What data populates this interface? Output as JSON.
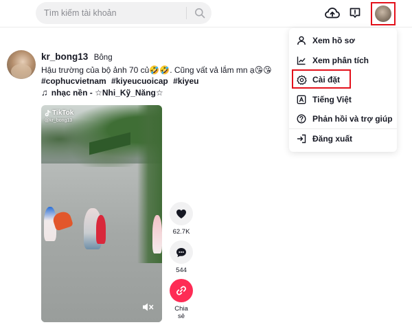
{
  "header": {
    "search_placeholder": "Tìm kiếm tài khoản",
    "icons": {
      "search": "search-icon",
      "upload": "cloud-upload-icon",
      "inbox": "inbox-icon",
      "avatar": "user-avatar"
    }
  },
  "post": {
    "username": "kr_bong13",
    "nickname": "Bông",
    "caption_line": "Hậu trường của bộ ảnh 70 củ🤣🤣. Cũng vất vả lắm mn ạ😘😘",
    "hashtags": [
      "#cophucvietnam",
      "#kiyeucuoicap",
      "#kiyeu"
    ],
    "music": "nhạc nền - ☆Nhi_Kỹ_Năng☆",
    "video": {
      "watermark": "TikTok",
      "handle": "@kr_bong13"
    },
    "actions": {
      "likes": "62.7K",
      "comments": "544",
      "share_label_line1": "Chia",
      "share_label_line2": "sẻ"
    }
  },
  "menu": {
    "items": [
      {
        "label": "Xem hồ sơ",
        "icon": "person-icon"
      },
      {
        "label": "Xem phân tích",
        "icon": "analytics-icon"
      },
      {
        "label": "Cài đặt",
        "icon": "settings-icon"
      },
      {
        "label": "Tiếng Việt",
        "icon": "language-icon"
      },
      {
        "label": "Phản hồi và trợ giúp",
        "icon": "help-icon"
      },
      {
        "label": "Đăng xuất",
        "icon": "logout-icon"
      }
    ]
  },
  "colors": {
    "accent_red": "#fe2c55",
    "highlight_border": "#e3101a",
    "text": "#161823",
    "search_bg": "#f1f1f2"
  }
}
